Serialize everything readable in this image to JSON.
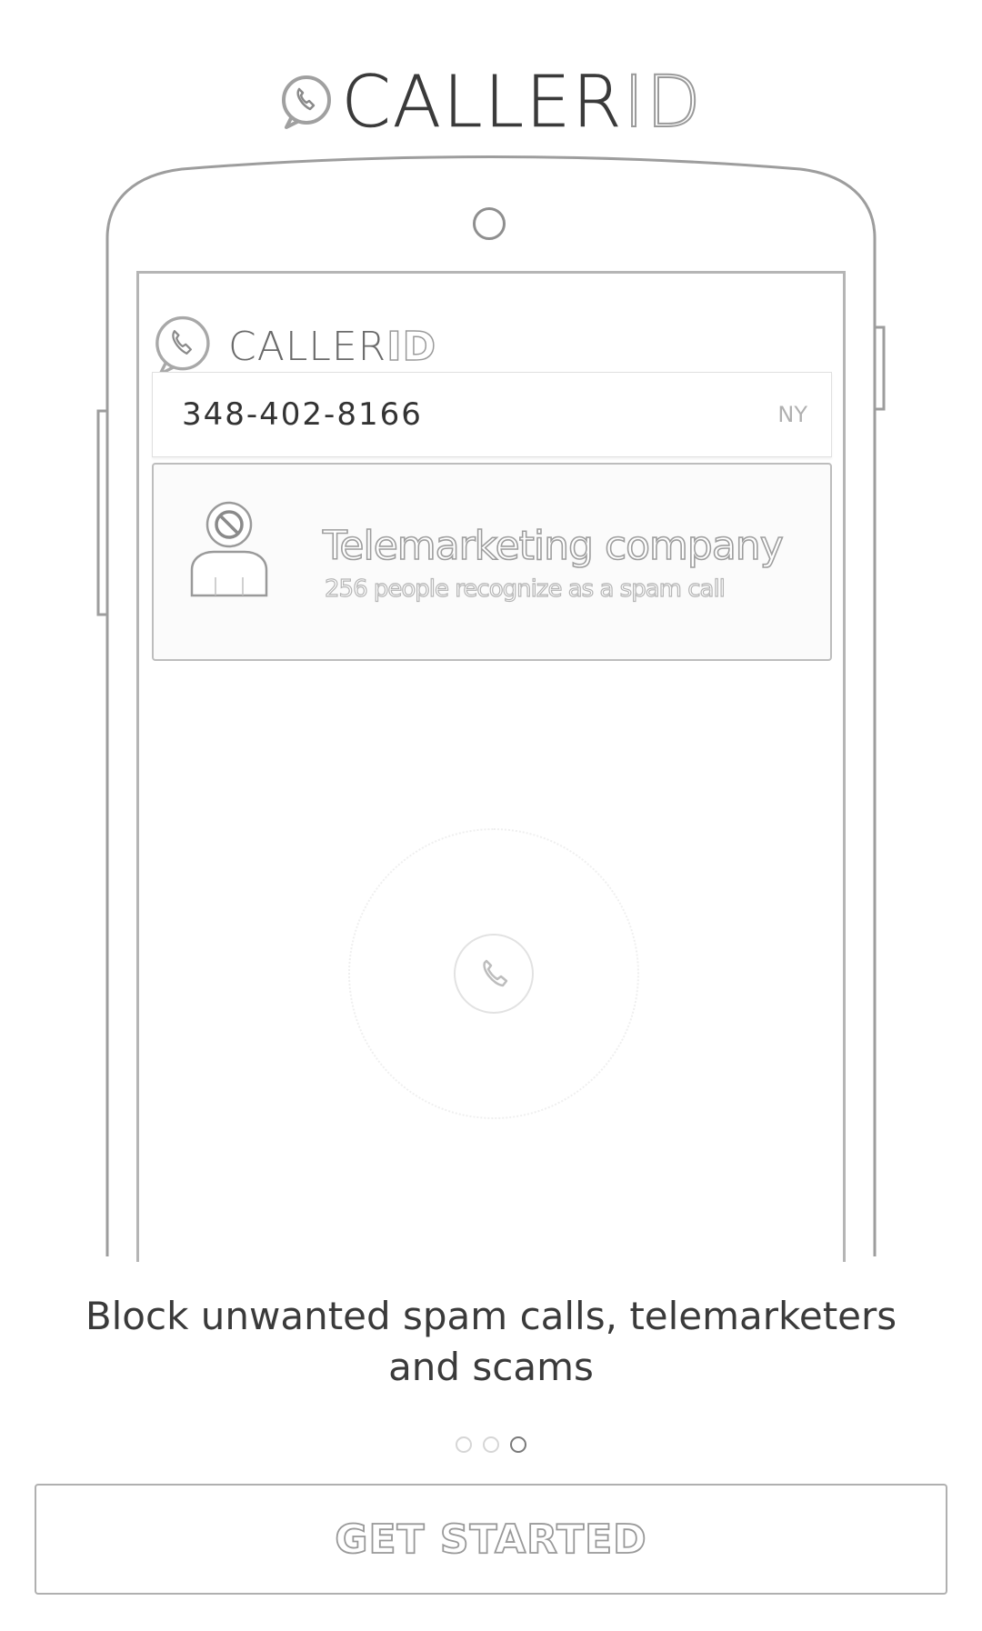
{
  "header": {
    "logo_icon": "phone-bubble-icon",
    "brand_main": "CALLER",
    "brand_accent": "ID"
  },
  "screen": {
    "logo_icon": "phone-bubble-icon",
    "brand_main": "CALLER",
    "brand_accent": "ID",
    "caller": {
      "number": "348-402-8166",
      "region": "NY"
    },
    "spam_card": {
      "avatar_icon": "blocked-user-icon",
      "title": "Telemarketing company",
      "subtitle": "256 people recognize as a spam call"
    },
    "call_icon": "phone-icon"
  },
  "tagline": "Block unwanted spam calls, telemarketers and scams",
  "pager": {
    "count": 3,
    "active_index": 2
  },
  "cta": {
    "label": "GET STARTED"
  }
}
